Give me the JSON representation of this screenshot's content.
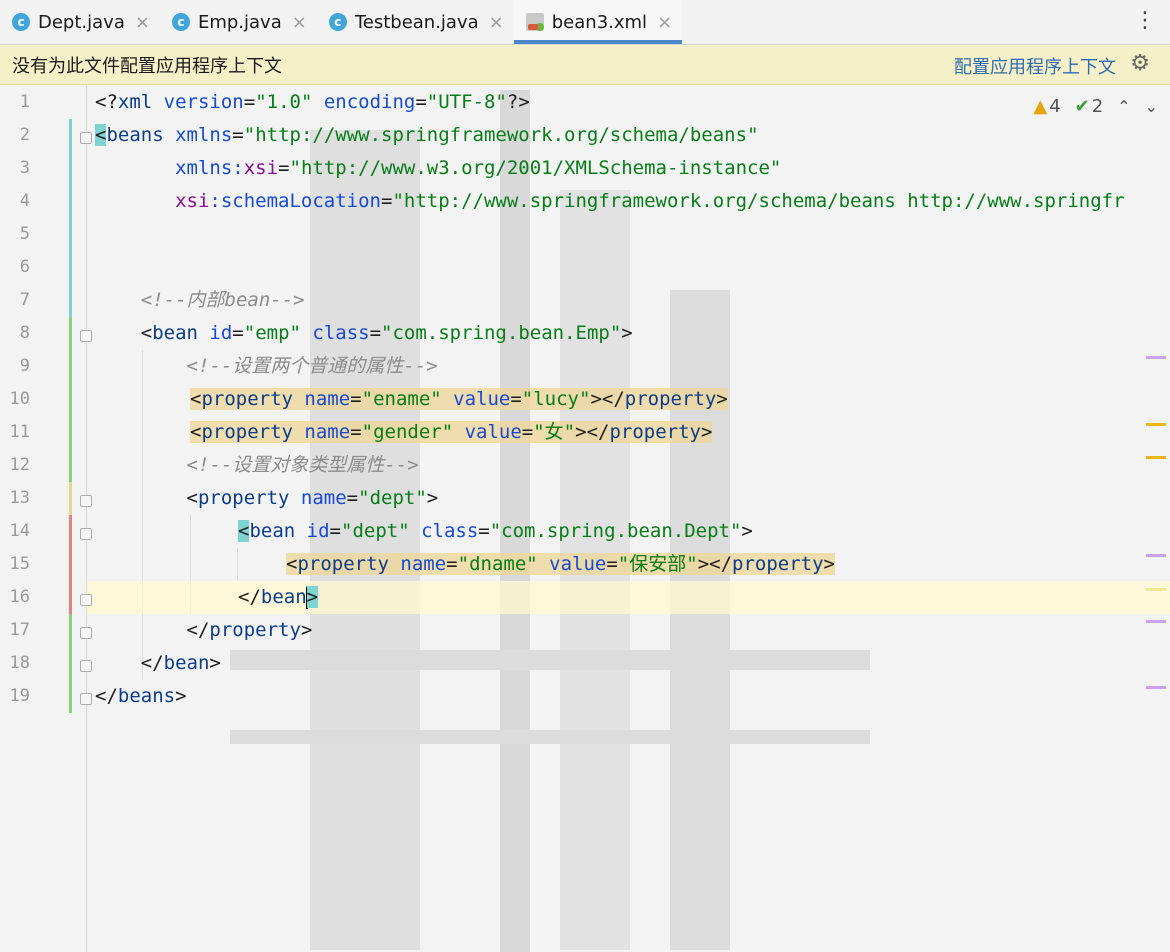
{
  "tabs": [
    {
      "label": "Dept.java",
      "icon": "class-icon",
      "active": false
    },
    {
      "label": "Emp.java",
      "icon": "class-icon",
      "active": false
    },
    {
      "label": "Testbean.java",
      "icon": "class-icon",
      "active": false
    },
    {
      "label": "bean3.xml",
      "icon": "xml-file-icon",
      "active": true
    }
  ],
  "banner": {
    "message": "没有为此文件配置应用程序上下文",
    "link": "配置应用程序上下文"
  },
  "inspections": {
    "warnings": "4",
    "weak_warnings": "2"
  },
  "line_numbers": [
    "1",
    "2",
    "3",
    "4",
    "5",
    "6",
    "7",
    "8",
    "9",
    "10",
    "11",
    "12",
    "13",
    "14",
    "15",
    "16",
    "17",
    "18",
    "19"
  ],
  "code": {
    "l1": {
      "a": "<?",
      "b": "xml",
      "c": " version",
      "d": "=",
      "e": "\"1.0\"",
      "f": " encoding",
      "g": "=",
      "h": "\"UTF-8\"",
      "i": "?>"
    },
    "l2": {
      "a": "<",
      "b": "beans",
      "c": " xmlns",
      "d": "=",
      "e": "\"http://www.springframework.org/schema/beans\""
    },
    "l3": {
      "a": "       xmlns:",
      "b": "xsi",
      "c": "=",
      "d": "\"http://www.w3.org/2001/XMLSchema-instance\""
    },
    "l4": {
      "a": "       ",
      "b": "xsi",
      "c": ":schemaLocation",
      "d": "=",
      "e": "\"http://www.springframework.org/schema/beans http://www.springfr"
    },
    "l7": {
      "a": "    <!--内部bean-->"
    },
    "l8": {
      "a": "    <",
      "b": "bean",
      "c": " id",
      "d": "=",
      "e": "\"emp\"",
      "f": " class",
      "g": "=",
      "h": "\"com.spring.bean.Emp\"",
      "i": ">"
    },
    "l9": {
      "a": "        <!--设置两个普通的属性-->"
    },
    "l10": {
      "a": "<",
      "b": "property",
      "c": " name",
      "d": "=",
      "e": "\"ename\"",
      "f": " value",
      "g": "=",
      "h": "\"lucy\"",
      "i": "></",
      "j": "property",
      "k": ">"
    },
    "l11": {
      "a": "<",
      "b": "property",
      "c": " name",
      "d": "=",
      "e": "\"gender\"",
      "f": " value",
      "g": "=",
      "h": "\"女\"",
      "i": "></",
      "j": "property",
      "k": ">"
    },
    "l12": {
      "a": "        <!--设置对象类型属性-->"
    },
    "l13": {
      "a": "        <",
      "b": "property",
      "c": " name",
      "d": "=",
      "e": "\"dept\"",
      "f": ">"
    },
    "l14": {
      "a": "<",
      "b": "bean",
      "c": " id",
      "d": "=",
      "e": "\"dept\"",
      "f": " class",
      "g": "=",
      "h": "\"com.spring.bean.Dept\"",
      "i": ">"
    },
    "l15": {
      "a": "<",
      "b": "property",
      "c": " name",
      "d": "=",
      "e": "\"dname\"",
      "f": " value",
      "g": "=",
      "h": "\"保安部\"",
      "i": "></",
      "j": "property",
      "k": ">"
    },
    "l16": {
      "a": "</",
      "b": "bea",
      "c": "n",
      "d": ">"
    },
    "l17": {
      "a": "        </",
      "b": "property",
      "c": ">"
    },
    "l18": {
      "a": "    </",
      "b": "bean",
      "c": ">"
    },
    "l19": {
      "a": "</",
      "b": "beans",
      "c": ">"
    }
  },
  "colors": {
    "tag": "#0b3c8c",
    "attribute": "#174ad4",
    "string": "#067d17",
    "comment": "#8c8c8c",
    "namespace": "#871094",
    "accent": "#4a86c8"
  }
}
